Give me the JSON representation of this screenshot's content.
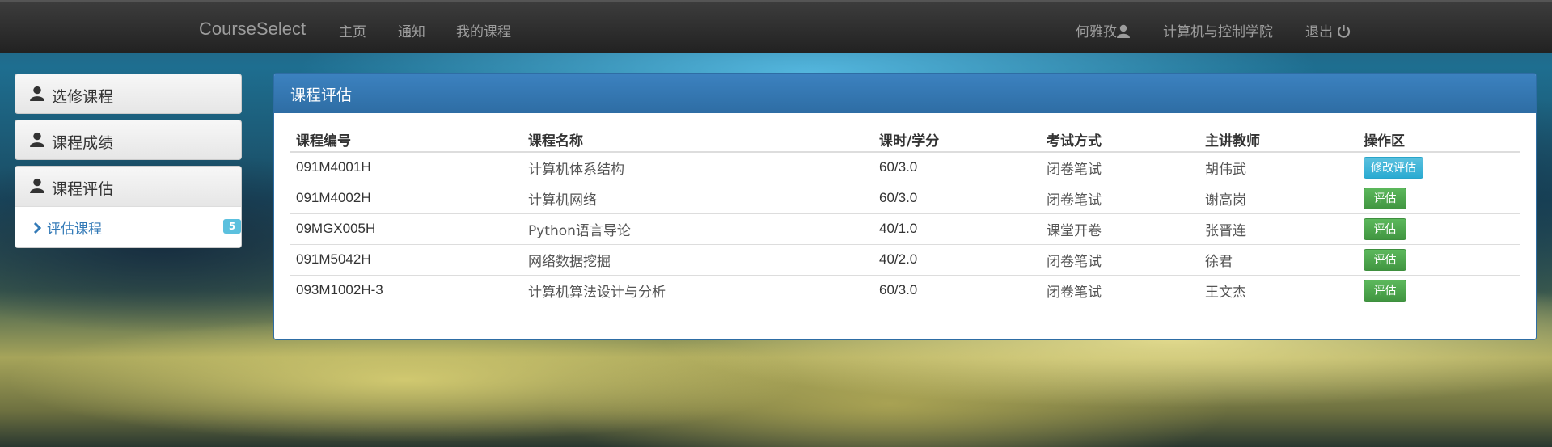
{
  "navbar": {
    "brand": "CourseSelect",
    "links": [
      "主页",
      "通知",
      "我的课程"
    ],
    "user": "何雅孜",
    "department": "计算机与控制学院",
    "logout": "退出"
  },
  "sidebar": {
    "items": [
      {
        "label": "选修课程",
        "icon": "user-icon"
      },
      {
        "label": "课程成绩",
        "icon": "user-icon"
      }
    ],
    "group": {
      "label": "课程评估",
      "icon": "user-icon",
      "sub_item": "评估课程",
      "badge": "5"
    }
  },
  "panel": {
    "title": "课程评估",
    "columns": [
      "课程编号",
      "课程名称",
      "课时/学分",
      "考试方式",
      "主讲教师",
      "操作区"
    ],
    "rows": [
      {
        "code": "091M4001H",
        "name": "计算机体系结构",
        "hours": "60/3.0",
        "exam": "闭卷笔试",
        "teacher": "胡伟武",
        "action": "修改评估",
        "action_type": "info"
      },
      {
        "code": "091M4002H",
        "name": "计算机网络",
        "hours": "60/3.0",
        "exam": "闭卷笔试",
        "teacher": "谢高岗",
        "action": "评估",
        "action_type": "success"
      },
      {
        "code": "09MGX005H",
        "name": "Python语言导论",
        "hours": "40/1.0",
        "exam": "课堂开卷",
        "teacher": "张晋连",
        "action": "评估",
        "action_type": "success"
      },
      {
        "code": "091M5042H",
        "name": "网络数据挖掘",
        "hours": "40/2.0",
        "exam": "闭卷笔试",
        "teacher": "徐君",
        "action": "评估",
        "action_type": "success"
      },
      {
        "code": "093M1002H-3",
        "name": "计算机算法设计与分析",
        "hours": "60/3.0",
        "exam": "闭卷笔试",
        "teacher": "王文杰",
        "action": "评估",
        "action_type": "success"
      }
    ]
  },
  "colors": {
    "navbar": "#222222",
    "panel_primary": "#337ab7",
    "info": "#5bc0de",
    "success": "#5cb85c"
  }
}
